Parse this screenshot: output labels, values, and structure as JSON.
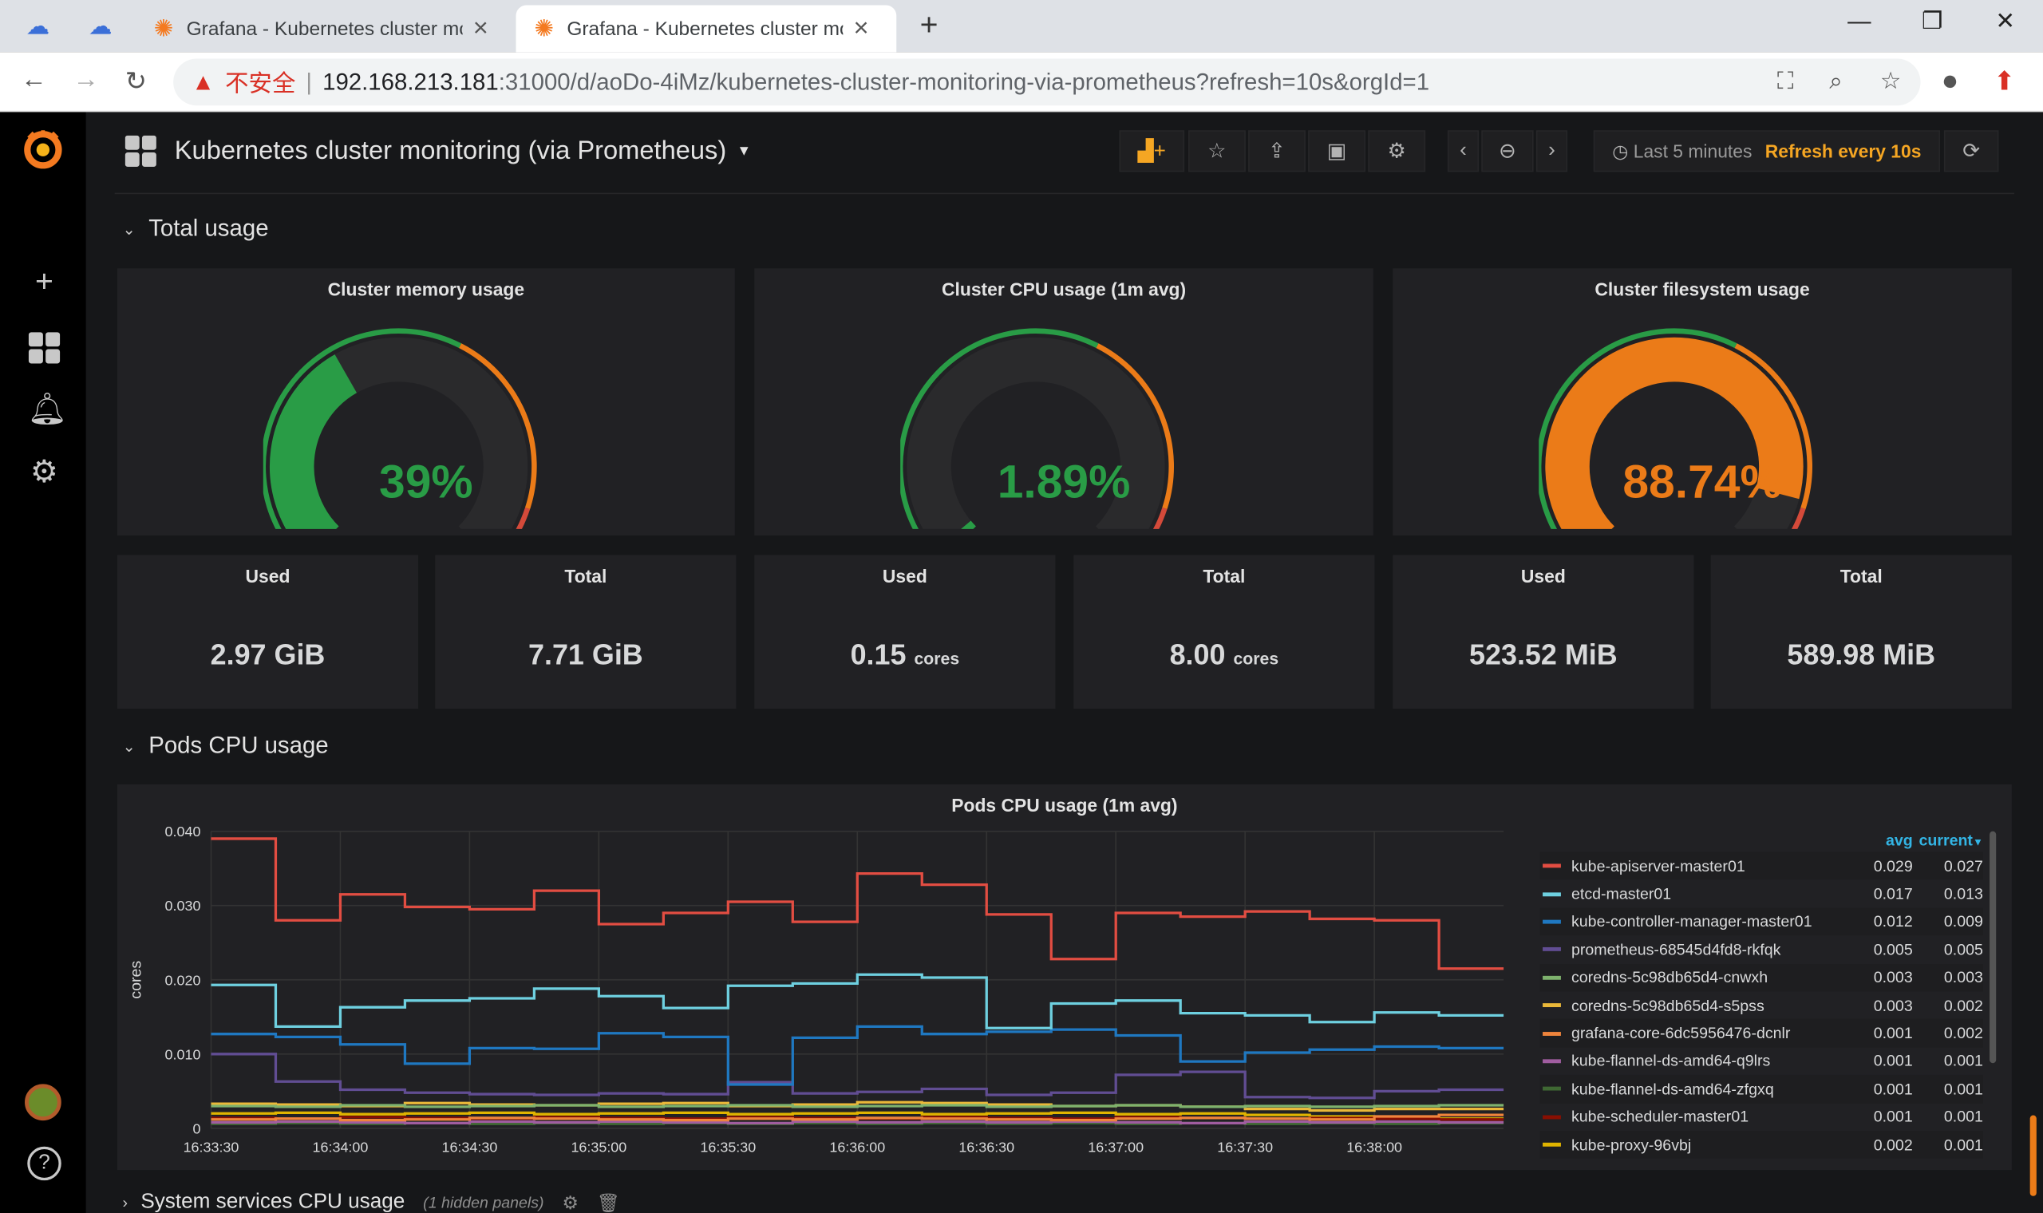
{
  "browser": {
    "tabs": [
      {
        "title": "Grafana - Kubernetes cluster monitoring (via Prometheus)",
        "active": false
      },
      {
        "title": "Grafana - Kubernetes cluster monitoring (via Prometheus)",
        "active": true
      }
    ],
    "new_tab": "+",
    "address": {
      "warning": "不安全",
      "host": "192.168.213.181",
      "path": ":31000/d/aoDo-4iMz/kubernetes-cluster-monitoring-via-prometheus?refresh=10s&orgId=1"
    }
  },
  "dashboard": {
    "title": "Kubernetes cluster monitoring (via Prometheus)",
    "time_range": "Last 5 minutes",
    "refresh": "Refresh every 10s"
  },
  "rows": {
    "total_usage": "Total usage",
    "pods_cpu": "Pods CPU usage",
    "system_services": "System services CPU usage",
    "hidden_panels": "(1 hidden panels)"
  },
  "gauges": [
    {
      "title": "Cluster memory usage",
      "value": "39%",
      "fraction": 0.39,
      "color": "#299c46"
    },
    {
      "title": "Cluster CPU usage (1m avg)",
      "value": "1.89%",
      "fraction": 0.0189,
      "color": "#299c46"
    },
    {
      "title": "Cluster filesystem usage",
      "value": "88.74%",
      "fraction": 0.8874,
      "color": "#e5ac0e"
    }
  ],
  "stats": [
    {
      "label": "Used",
      "value": "2.97 GiB",
      "unit": ""
    },
    {
      "label": "Total",
      "value": "7.71 GiB",
      "unit": ""
    },
    {
      "label": "Used",
      "value": "0.15",
      "unit": "cores"
    },
    {
      "label": "Total",
      "value": "8.00",
      "unit": "cores"
    },
    {
      "label": "Used",
      "value": "523.52 MiB",
      "unit": ""
    },
    {
      "label": "Total",
      "value": "589.98 MiB",
      "unit": ""
    }
  ],
  "legend_headers": {
    "avg": "avg",
    "current": "current"
  },
  "chart_data": {
    "type": "line",
    "title": "Pods CPU usage (1m avg)",
    "ylabel": "cores",
    "ylim": [
      0,
      0.04
    ],
    "yticks": [
      "0",
      "0.010",
      "0.020",
      "0.030",
      "0.040"
    ],
    "xticks": [
      "16:33:30",
      "16:34:00",
      "16:34:30",
      "16:35:00",
      "16:35:30",
      "16:36:00",
      "16:36:30",
      "16:37:00",
      "16:37:30",
      "16:38:00"
    ],
    "x": [
      "16:33:30",
      "16:33:45",
      "16:34:00",
      "16:34:15",
      "16:34:30",
      "16:34:45",
      "16:35:00",
      "16:35:15",
      "16:35:30",
      "16:35:45",
      "16:36:00",
      "16:36:15",
      "16:36:30",
      "16:36:45",
      "16:37:00",
      "16:37:15",
      "16:37:30",
      "16:37:45",
      "16:38:00",
      "16:38:15"
    ],
    "series": [
      {
        "name": "kube-apiserver-master01",
        "color": "#e24d42",
        "avg": "0.029",
        "current": "0.027",
        "values": [
          0.039,
          0.028,
          0.0315,
          0.0298,
          0.0295,
          0.032,
          0.0275,
          0.029,
          0.0305,
          0.0278,
          0.0343,
          0.0328,
          0.0288,
          0.0228,
          0.029,
          0.0285,
          0.0292,
          0.0282,
          0.028,
          0.0215
        ]
      },
      {
        "name": "etcd-master01",
        "color": "#6ed0e0",
        "avg": "0.017",
        "current": "0.013",
        "values": [
          0.0193,
          0.0137,
          0.0163,
          0.0172,
          0.0175,
          0.0188,
          0.0178,
          0.0162,
          0.0192,
          0.0195,
          0.0207,
          0.0203,
          0.0135,
          0.0168,
          0.0172,
          0.0155,
          0.0152,
          0.0143,
          0.0156,
          0.0152
        ]
      },
      {
        "name": "kube-controller-manager-master01",
        "color": "#1f78c1",
        "avg": "0.012",
        "current": "0.009",
        "values": [
          0.0127,
          0.0123,
          0.0113,
          0.0087,
          0.0108,
          0.0107,
          0.0128,
          0.0123,
          0.0059,
          0.0122,
          0.0137,
          0.0127,
          0.013,
          0.0133,
          0.0125,
          0.009,
          0.0102,
          0.0106,
          0.011,
          0.0108
        ]
      },
      {
        "name": "prometheus-68545d4fd8-rkfqk",
        "color": "#614d93",
        "avg": "0.005",
        "current": "0.005",
        "values": [
          0.01,
          0.0063,
          0.0052,
          0.0048,
          0.0046,
          0.0045,
          0.0047,
          0.0046,
          0.0062,
          0.0047,
          0.0049,
          0.0053,
          0.0045,
          0.0048,
          0.0072,
          0.0076,
          0.0042,
          0.0041,
          0.005,
          0.0052
        ]
      },
      {
        "name": "coredns-5c98db65d4-cnwxh",
        "color": "#7eb26d",
        "avg": "0.003",
        "current": "0.003",
        "values": [
          0.003,
          0.0029,
          0.0031,
          0.0029,
          0.003,
          0.0031,
          0.0029,
          0.003,
          0.0031,
          0.0029,
          0.003,
          0.0031,
          0.0029,
          0.003,
          0.0031,
          0.0029,
          0.003,
          0.0029,
          0.003,
          0.0031
        ]
      },
      {
        "name": "coredns-5c98db65d4-s5pss",
        "color": "#eab839",
        "avg": "0.003",
        "current": "0.002",
        "values": [
          0.0033,
          0.0032,
          0.003,
          0.0034,
          0.0032,
          0.0031,
          0.0033,
          0.0034,
          0.003,
          0.0032,
          0.0035,
          0.0034,
          0.0032,
          0.003,
          0.0031,
          0.0029,
          0.0026,
          0.0024,
          0.0026,
          0.0026
        ]
      },
      {
        "name": "grafana-core-6dc5956476-dcnlr",
        "color": "#ef843c",
        "avg": "0.001",
        "current": "0.002",
        "values": [
          0.0012,
          0.0013,
          0.0011,
          0.0012,
          0.0014,
          0.0013,
          0.0012,
          0.0011,
          0.0013,
          0.0012,
          0.0014,
          0.0013,
          0.0012,
          0.0011,
          0.0013,
          0.0014,
          0.0013,
          0.0012,
          0.0016,
          0.0018
        ]
      },
      {
        "name": "kube-flannel-ds-amd64-q9lrs",
        "color": "#a05da0",
        "avg": "0.001",
        "current": "0.001",
        "values": [
          0.0008,
          0.0009,
          0.0008,
          0.0007,
          0.0009,
          0.0008,
          0.0009,
          0.0008,
          0.0007,
          0.0009,
          0.0008,
          0.0009,
          0.0008,
          0.0009,
          0.0008,
          0.0007,
          0.0009,
          0.0008,
          0.0009,
          0.0008
        ]
      },
      {
        "name": "kube-flannel-ds-amd64-zfgxq",
        "color": "#3f6833",
        "avg": "0.001",
        "current": "0.001",
        "values": [
          0.0006,
          0.0007,
          0.0006,
          0.0007,
          0.0006,
          0.0007,
          0.0006,
          0.0007,
          0.0006,
          0.0007,
          0.0006,
          0.0007,
          0.0006,
          0.0007,
          0.0006,
          0.0007,
          0.0006,
          0.0007,
          0.0006,
          0.0007
        ]
      },
      {
        "name": "kube-scheduler-master01",
        "color": "#890f02",
        "avg": "0.001",
        "current": "0.001",
        "values": [
          0.0014,
          0.0013,
          0.0015,
          0.0014,
          0.0013,
          0.0015,
          0.0014,
          0.0013,
          0.0015,
          0.0014,
          0.0013,
          0.0015,
          0.0014,
          0.0013,
          0.0015,
          0.0014,
          0.0013,
          0.0014,
          0.0013,
          0.0012
        ]
      },
      {
        "name": "kube-proxy-96vbj",
        "color": "#e0b400",
        "avg": "0.002",
        "current": "0.001",
        "values": [
          0.002,
          0.0021,
          0.0019,
          0.002,
          0.0021,
          0.0019,
          0.002,
          0.0021,
          0.0019,
          0.002,
          0.0021,
          0.0019,
          0.002,
          0.0021,
          0.0019,
          0.002,
          0.0018,
          0.0016,
          0.0014,
          0.0013
        ]
      }
    ]
  }
}
